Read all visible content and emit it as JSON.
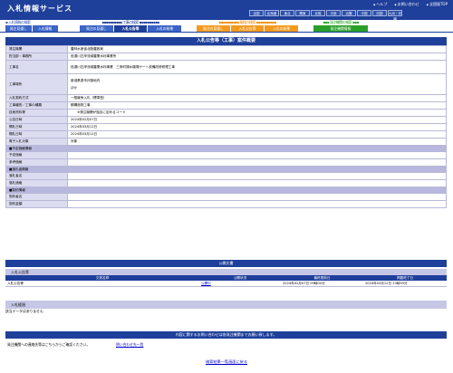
{
  "header": {
    "title": "入札情報サービス",
    "links": [
      "ヘルプ",
      "お問い合わせ",
      "全国版TOP"
    ],
    "regions": [
      "全国",
      "北海道",
      "東北",
      "関東",
      "北陸",
      "中部",
      "近畿",
      "中国",
      "四国",
      "九州・沖縄"
    ]
  },
  "nav": {
    "groups": [
      {
        "title": "入札情報の検索",
        "tabs": [
          "発注見通し",
          "入札情報"
        ],
        "color": "#3a64c6",
        "title_color": "#2d50ad"
      },
      {
        "title": "工事の検索",
        "tabs": [
          "発注の見通し",
          "入札公告等",
          "入札の結果"
        ],
        "color": "#1e3f9a",
        "title_color": "#1e3f9a"
      },
      {
        "title": "業務の検索",
        "tabs": [
          "発注の見通し",
          "入札公告等",
          "入札の結果"
        ],
        "color": "#f08a00",
        "title_color": "#f08a00"
      },
      {
        "title": "発注機関の検索",
        "tabs": [
          "発注機関情報"
        ],
        "color": "#2aa02a",
        "title_color": "#2aa02a"
      }
    ]
  },
  "detail": {
    "title": "入札公告等（工事）案件概要",
    "rows": [
      {
        "label": "発注機関",
        "value": "農林水産省北陸農政局"
      },
      {
        "label": "担当部・事務所",
        "value": "信濃川左岸流域農業水利事業所"
      },
      {
        "label": "工事名",
        "value": "信濃川左岸流域農業水利事業　三条町揚水機場ゲート設備改修修理工事"
      },
      {
        "label": "工事場所",
        "value": "新潟県燕市戸隠地内",
        "value2": "ほか"
      },
      {
        "label": "入札契約方式",
        "value": "一般競争入札（標準型）"
      },
      {
        "label": "工事種別／工事の種類",
        "value": "鋼構造物工事"
      },
      {
        "label": "技術資料等",
        "value": "　　※発注機関が独自に定めるコード"
      },
      {
        "label": "公告日時",
        "value": "2024年02月07日"
      },
      {
        "label": "開札日時",
        "value": "2024年03月12日"
      },
      {
        "label": "開札日時",
        "value": "2024年03月12日"
      },
      {
        "label": "電子入札対象",
        "value": "対象"
      }
    ],
    "sections": [
      {
        "title": "■予定価格情報",
        "rows": [
          "予定価格",
          "参考価格"
        ]
      },
      {
        "title": "■落札者情報",
        "rows": [
          "落札者名",
          "落札価格"
        ]
      },
      {
        "title": "■契約情報",
        "rows": [
          "契約者名",
          "契約金額"
        ]
      }
    ]
  },
  "notice": {
    "title": "公開文書",
    "subtitle": "入札公告等",
    "headers": [
      "文書名称",
      "公開状況",
      "最終更新日",
      "掲載終了日"
    ],
    "row": {
      "name": "入札公告等",
      "status": "公開中",
      "updated": "2024年02月07日 09時00分",
      "end": "2024年03月12日 23時59分"
    }
  },
  "result": {
    "subtitle": "入札経過",
    "empty": "該当データはありません"
  },
  "contact": {
    "title": "内容に関するお問い合わせは各発注機関までお願い致します。",
    "text": "発注機関への連絡先等はこちらからご確認ください。",
    "link": "問い合わせ先一覧"
  },
  "back_link": "検索結果一覧画面に戻る"
}
